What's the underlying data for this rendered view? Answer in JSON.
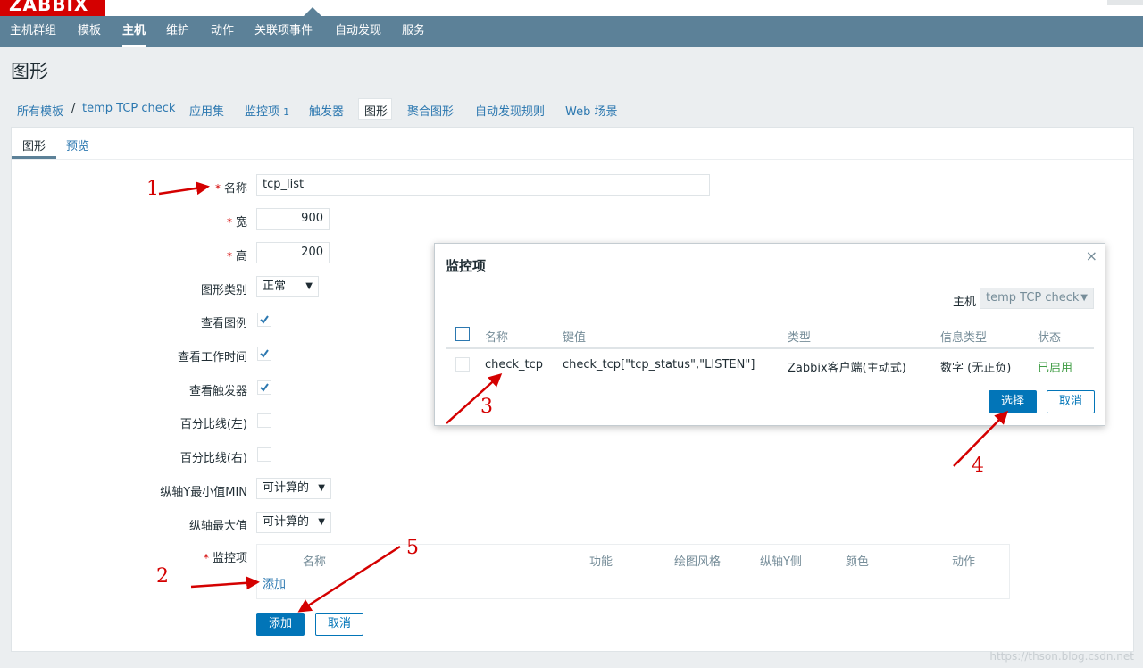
{
  "app": {
    "logo": "ZABBIX"
  },
  "nav": {
    "items": [
      "主机群组",
      "模板",
      "主机",
      "维护",
      "动作",
      "关联项事件",
      "自动发现",
      "服务"
    ],
    "active_index": 2
  },
  "page": {
    "title": "图形"
  },
  "breadcrumb": {
    "all_templates": "所有模板",
    "separator": "/",
    "template": "temp TCP check",
    "applications": "应用集",
    "items": "监控项",
    "items_count": "1",
    "triggers": "触发器",
    "graphs": "图形",
    "screens": "聚合图形",
    "discovery": "自动发现规则",
    "web": "Web 场景"
  },
  "tabs": [
    "图形",
    "预览"
  ],
  "form": {
    "name_label": "名称",
    "name_value": "tcp_list",
    "width_label": "宽",
    "width_value": "900",
    "height_label": "高",
    "height_value": "200",
    "graph_type_label": "图形类别",
    "graph_type_value": "正常",
    "show_legend_label": "查看图例",
    "show_working_time_label": "查看工作时间",
    "show_triggers_label": "查看触发器",
    "percentile_left_label": "百分比线(左)",
    "percentile_right_label": "百分比线(右)",
    "ymin_label": "纵轴Y最小值MIN",
    "ymin_value": "可计算的",
    "ymax_label": "纵轴最大值",
    "ymax_value": "可计算的",
    "items_label": "监控项",
    "items_headers": [
      "名称",
      "功能",
      "绘图风格",
      "纵轴Y侧",
      "颜色",
      "动作"
    ],
    "add_link": "添加",
    "submit": "添加",
    "cancel": "取消"
  },
  "modal": {
    "title": "监控项",
    "close": "×",
    "host_label": "主机",
    "host_value": "temp TCP check",
    "headers": [
      "名称",
      "键值",
      "类型",
      "信息类型",
      "状态"
    ],
    "row": {
      "name": "check_tcp",
      "key": "check_tcp[\"tcp_status\",\"LISTEN\"]",
      "type": "Zabbix客户端(主动式)",
      "info_type": "数字 (无正负)",
      "status": "已启用"
    },
    "select_button": "选择",
    "cancel_button": "取消"
  },
  "annotations": [
    "1",
    "2",
    "3",
    "4",
    "5"
  ],
  "watermark": "https://thson.blog.csdn.net",
  "colors": {
    "nav_bg": "#5c8198",
    "link": "#2c78b0",
    "primary": "#0275b8",
    "required": "#d40000",
    "enabled": "#429e47",
    "annotation": "#d40000"
  }
}
